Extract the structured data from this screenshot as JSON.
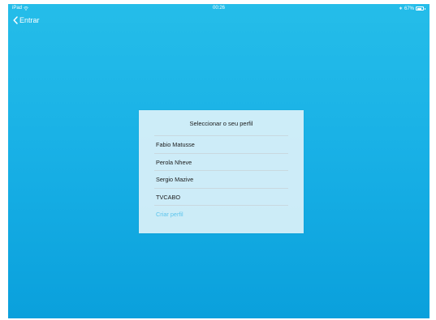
{
  "status_bar": {
    "device": "iPad",
    "time": "00:26",
    "battery_text": "67%",
    "battery_level": 0.67
  },
  "nav": {
    "back_label": "Entrar"
  },
  "panel": {
    "title": "Seleccionar o seu perfil",
    "profiles": [
      "Fabio Matusse",
      "Perola Nheve",
      "Sergio Mazive",
      "TVCABO"
    ],
    "create_label": "Criar perfil"
  },
  "colors": {
    "background_top": "#25bde9",
    "background_bottom": "#0aa0dc",
    "accent": "#5cc4ec"
  }
}
